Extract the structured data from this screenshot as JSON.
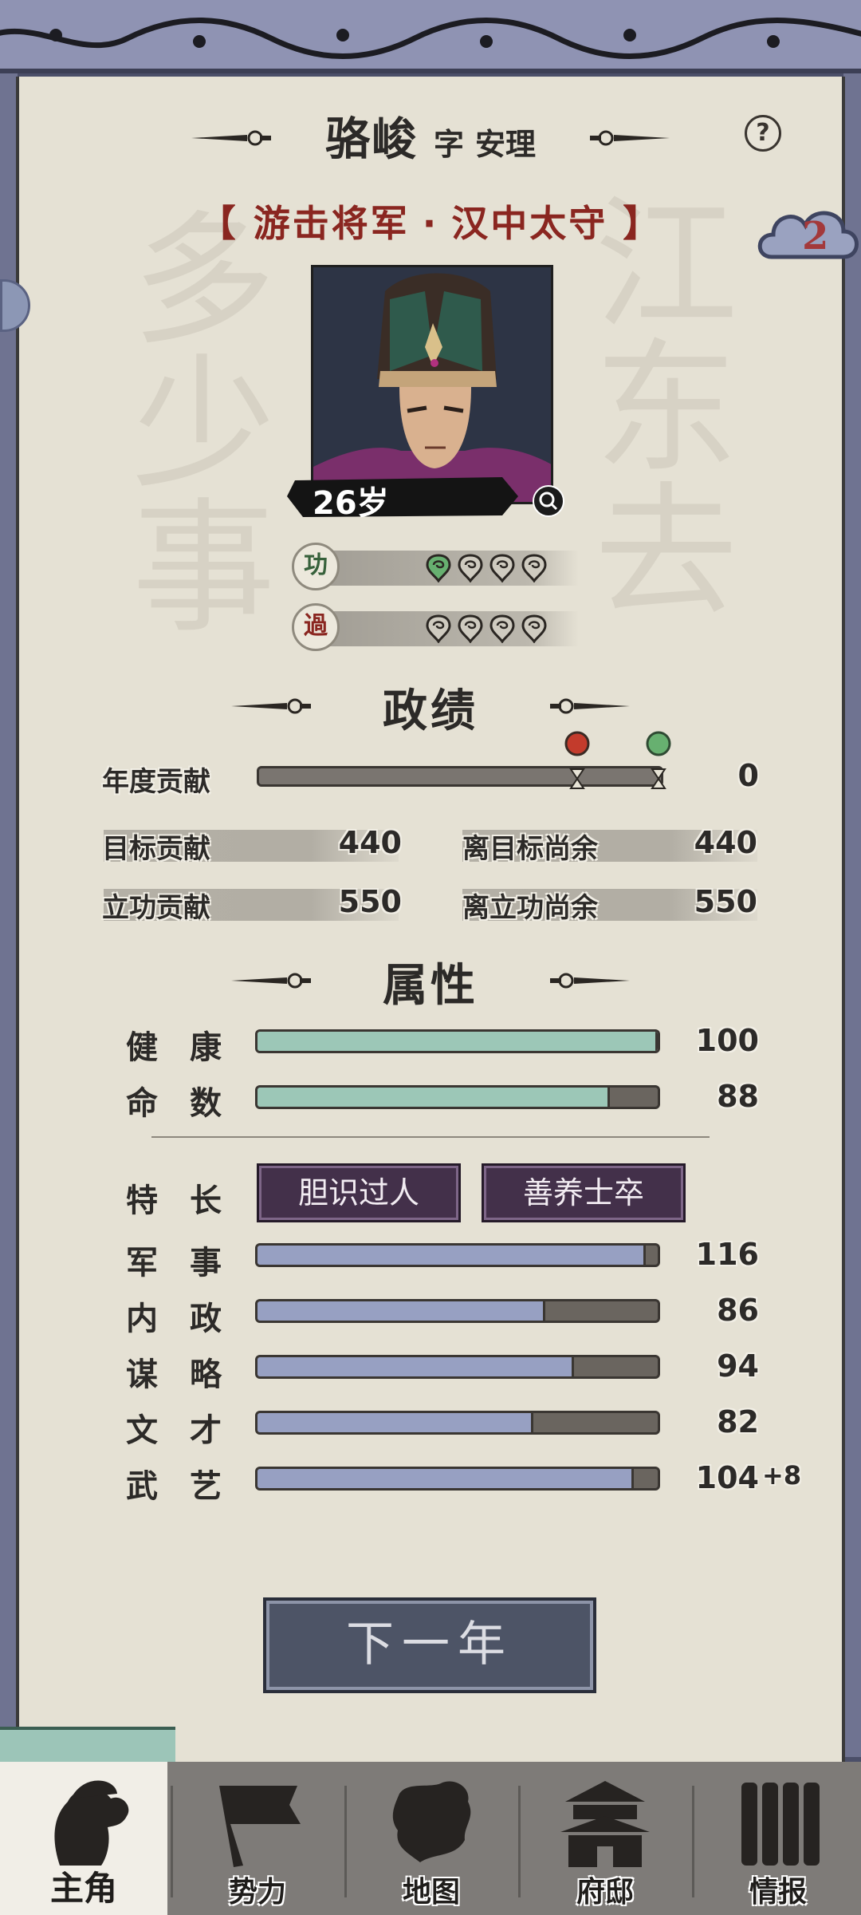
{
  "header": {
    "name": "骆峻",
    "courtesy_prefix": "字",
    "courtesy": "安理",
    "titles_left_bracket": "【",
    "title1": "游击将军",
    "separator": "·",
    "title2": "汉中太守",
    "titles_right_bracket": "】",
    "help_icon": "?",
    "badge_count": "2"
  },
  "portrait": {
    "age": "26岁"
  },
  "merit": {
    "icon_label": "功",
    "filled": 1,
    "total": 4
  },
  "fault": {
    "icon_label": "過",
    "filled": 0,
    "total": 4
  },
  "performance": {
    "title": "政绩",
    "annual_label": "年度贡献",
    "annual_value": "0",
    "target_label": "目标贡献",
    "target_value": "440",
    "to_target_label": "离目标尚余",
    "to_target_value": "440",
    "merit_label": "立功贡献",
    "merit_value": "550",
    "to_merit_label": "离立功尚余",
    "to_merit_value": "550"
  },
  "attributes": {
    "title": "属性",
    "health_label": "健康",
    "health_value": "100",
    "health_fill": 1.0,
    "fate_label": "命数",
    "fate_value": "88",
    "fate_fill": 0.88,
    "traits_label": "特长",
    "traits": [
      "胆识过人",
      "善养士卒"
    ],
    "stats": [
      {
        "label": "军事",
        "value": "116",
        "bonus": "",
        "fill": 0.97
      },
      {
        "label": "内政",
        "value": "86",
        "bonus": "",
        "fill": 0.72
      },
      {
        "label": "谋略",
        "value": "94",
        "bonus": "",
        "fill": 0.79
      },
      {
        "label": "文才",
        "value": "82",
        "bonus": "",
        "fill": 0.69
      },
      {
        "label": "武艺",
        "value": "104",
        "bonus": "+8",
        "fill": 0.94
      }
    ]
  },
  "actions": {
    "next_year": "下一年"
  },
  "nav": [
    {
      "label": "主角",
      "icon": "warrior-head-icon",
      "active": true
    },
    {
      "label": "势力",
      "icon": "flag-icon",
      "active": false
    },
    {
      "label": "地图",
      "icon": "map-icon",
      "active": false
    },
    {
      "label": "府邸",
      "icon": "mansion-icon",
      "active": false
    },
    {
      "label": "情报",
      "icon": "scroll-icon",
      "active": false
    }
  ],
  "colors": {
    "title_red": "#8a2620",
    "health_bar": "#9cc7b7",
    "stat_bar": "#97a0c2",
    "trait_button": "#43304a",
    "frame": "#4b4f69"
  }
}
